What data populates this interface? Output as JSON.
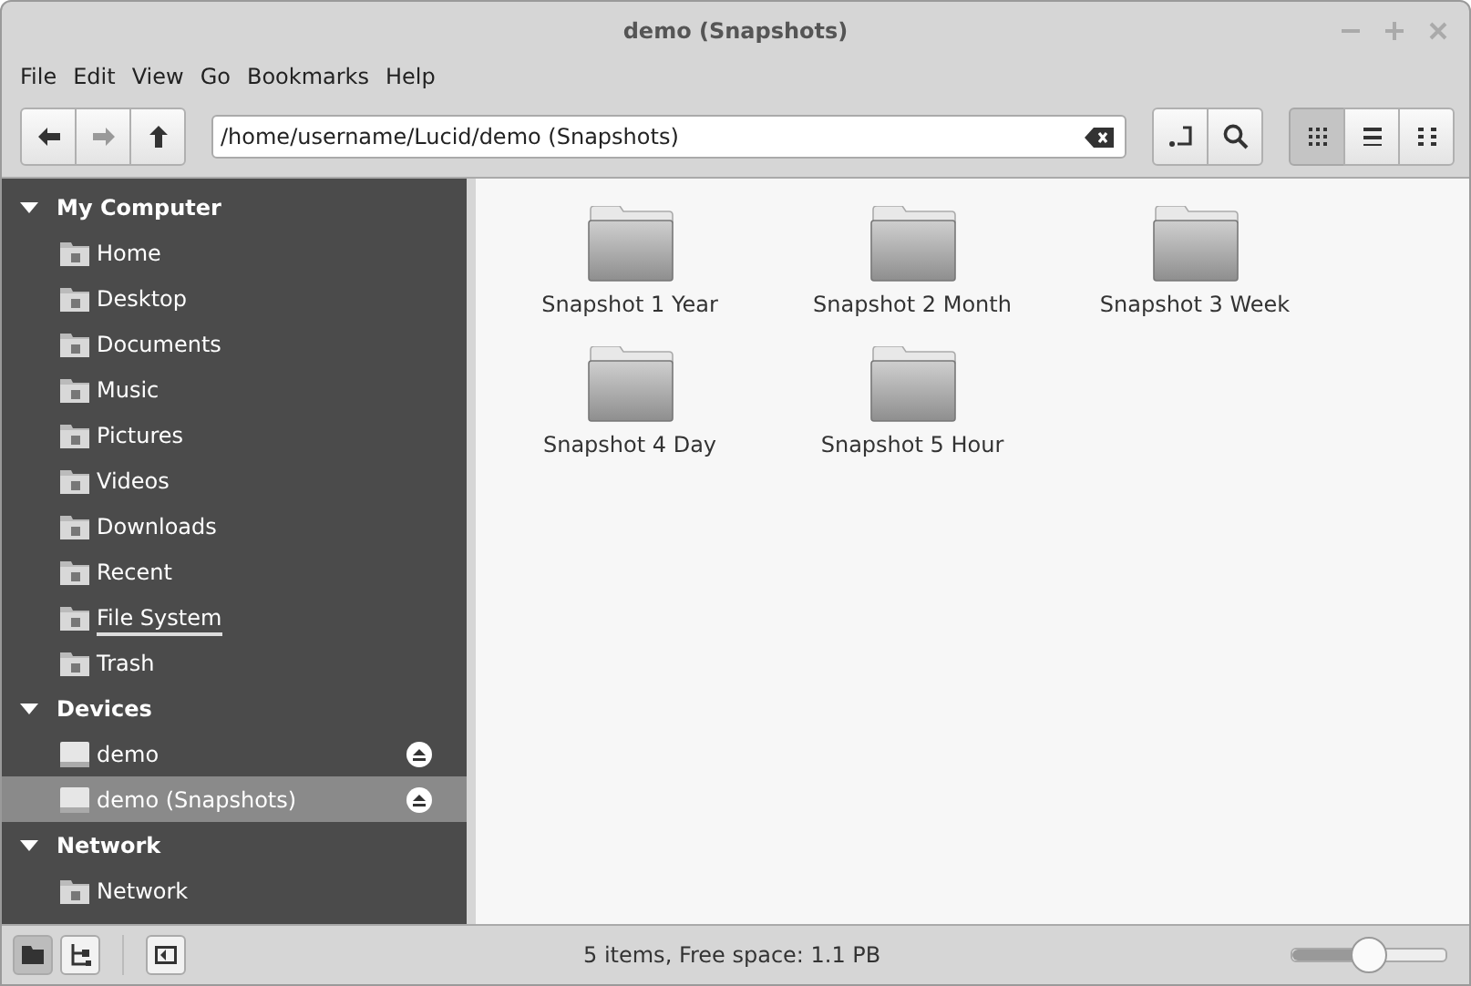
{
  "window": {
    "title": "demo (Snapshots)"
  },
  "menu": [
    "File",
    "Edit",
    "View",
    "Go",
    "Bookmarks",
    "Help"
  ],
  "location": {
    "value": "/home/username/Lucid/demo (Snapshots)"
  },
  "view_modes": [
    {
      "kind": "icons",
      "selected": true
    },
    {
      "kind": "list",
      "selected": false
    },
    {
      "kind": "compact",
      "selected": false
    }
  ],
  "sidebar": {
    "sections": [
      {
        "title": "My Computer",
        "expanded": true,
        "kind": "places",
        "items": [
          {
            "label": "Home",
            "selected": false,
            "hovered": false,
            "ejectable": false
          },
          {
            "label": "Desktop",
            "selected": false,
            "hovered": false,
            "ejectable": false
          },
          {
            "label": "Documents",
            "selected": false,
            "hovered": false,
            "ejectable": false
          },
          {
            "label": "Music",
            "selected": false,
            "hovered": false,
            "ejectable": false
          },
          {
            "label": "Pictures",
            "selected": false,
            "hovered": false,
            "ejectable": false
          },
          {
            "label": "Videos",
            "selected": false,
            "hovered": false,
            "ejectable": false
          },
          {
            "label": "Downloads",
            "selected": false,
            "hovered": false,
            "ejectable": false
          },
          {
            "label": "Recent",
            "selected": false,
            "hovered": false,
            "ejectable": false
          },
          {
            "label": "File System",
            "selected": false,
            "hovered": true,
            "ejectable": false
          },
          {
            "label": "Trash",
            "selected": false,
            "hovered": false,
            "ejectable": false
          }
        ]
      },
      {
        "title": "Devices",
        "expanded": true,
        "kind": "devices",
        "items": [
          {
            "label": "demo",
            "selected": false,
            "hovered": false,
            "ejectable": true
          },
          {
            "label": "demo (Snapshots)",
            "selected": true,
            "hovered": false,
            "ejectable": true
          }
        ]
      },
      {
        "title": "Network",
        "expanded": true,
        "kind": "network",
        "items": [
          {
            "label": "Network",
            "selected": false,
            "hovered": false,
            "ejectable": false
          }
        ]
      }
    ]
  },
  "files": [
    {
      "name": "Snapshot 1 Year"
    },
    {
      "name": "Snapshot 2 Month"
    },
    {
      "name": "Snapshot 3 Week"
    },
    {
      "name": "Snapshot 4 Day"
    },
    {
      "name": "Snapshot 5 Hour"
    }
  ],
  "status_bar": {
    "text": "5 items, Free space: 1.1 PB",
    "zoom": {
      "level": 0.5
    }
  }
}
